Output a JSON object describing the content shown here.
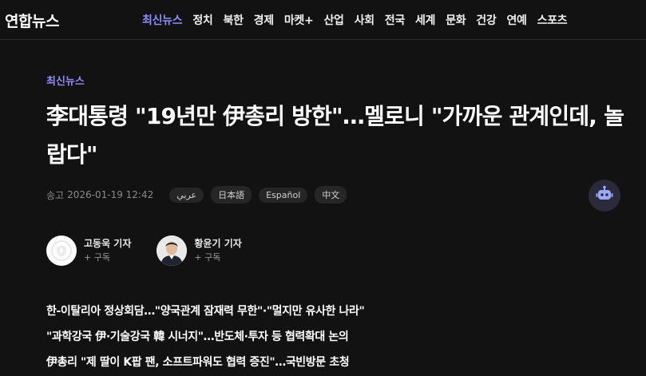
{
  "header": {
    "logo": "연합뉴스",
    "nav": [
      "최신뉴스",
      "정치",
      "북한",
      "경제",
      "마켓+",
      "산업",
      "사회",
      "전국",
      "세계",
      "문화",
      "건강",
      "연예",
      "스포츠"
    ],
    "active_nav": "최신뉴스",
    "accent_color": "#8c8cff"
  },
  "article": {
    "category": "최신뉴스",
    "headline": "李대통령 \"19년만 伊총리 방한\"…멜로니 \"가까운 관계인데, 놀랍다\"",
    "date_label": "송고",
    "date_value": "2026-01-19 12:42",
    "languages": [
      "عربي",
      "日本語",
      "Español",
      "中文"
    ],
    "bot_icon": "robot-icon",
    "reporters": [
      {
        "name": "고동욱 기자",
        "subscribe": "+ 구독",
        "avatar": "default-avatar-icon"
      },
      {
        "name": "황윤기 기자",
        "subscribe": "+ 구독",
        "avatar": "reporter-photo"
      }
    ],
    "summary": [
      "한-이탈리아 정상회담…\"양국관계 잠재력 무한\"·\"멀지만 유사한 나라\"",
      "\"과학강국 伊·기술강국 韓 시너지\"…반도체·투자 등 협력확대 논의",
      "伊총리 \"제 딸이 K팝 팬, 소프트파워도 협력 증진\"…국빈방문 초청"
    ]
  }
}
